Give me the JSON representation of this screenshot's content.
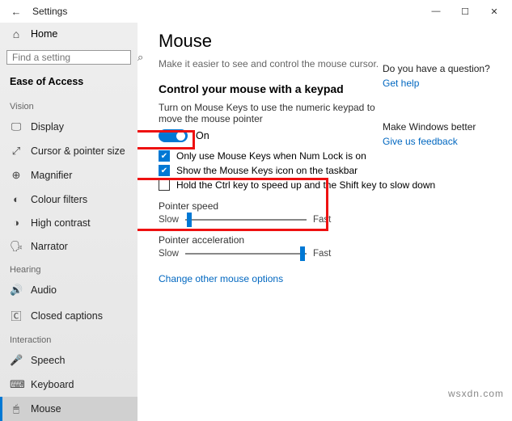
{
  "titlebar": {
    "title": "Settings",
    "back": "←",
    "min": "—",
    "max": "☐",
    "close": "✕"
  },
  "sidebar": {
    "home": "Home",
    "search_placeholder": "Find a setting",
    "ease": "Ease of Access",
    "groups": {
      "vision": {
        "label": "Vision",
        "items": [
          {
            "icon": "🖵",
            "label": "Display"
          },
          {
            "icon": "⤢",
            "label": "Cursor & pointer size"
          },
          {
            "icon": "⊕",
            "label": "Magnifier"
          },
          {
            "icon": "◐",
            "label": "Colour filters"
          },
          {
            "icon": "◑",
            "label": "High contrast"
          },
          {
            "icon": "🗣",
            "label": "Narrator"
          }
        ]
      },
      "hearing": {
        "label": "Hearing",
        "items": [
          {
            "icon": "🔊",
            "label": "Audio"
          },
          {
            "icon": "🄲",
            "label": "Closed captions"
          }
        ]
      },
      "interaction": {
        "label": "Interaction",
        "items": [
          {
            "icon": "🎤",
            "label": "Speech"
          },
          {
            "icon": "⌨",
            "label": "Keyboard"
          },
          {
            "icon": "🖱",
            "label": "Mouse"
          }
        ]
      }
    }
  },
  "main": {
    "h1": "Mouse",
    "sub": "Make it easier to see and control the mouse cursor.",
    "h2": "Control your mouse with a keypad",
    "desc": "Turn on Mouse Keys to use the numeric keypad to move the mouse pointer",
    "toggle": "On",
    "check1": "Only use Mouse Keys when Num Lock is on",
    "check2": "Show the Mouse Keys icon on the taskbar",
    "check3": "Hold the Ctrl key to speed up and the Shift key to slow down",
    "ps_label": "Pointer speed",
    "slow": "Slow",
    "fast": "Fast",
    "pa_label": "Pointer acceleration",
    "link": "Change other mouse options"
  },
  "right": {
    "q": "Do you have a question?",
    "help": "Get help",
    "better": "Make Windows better",
    "feedback": "Give us feedback"
  },
  "watermark": "wsxdn.com"
}
